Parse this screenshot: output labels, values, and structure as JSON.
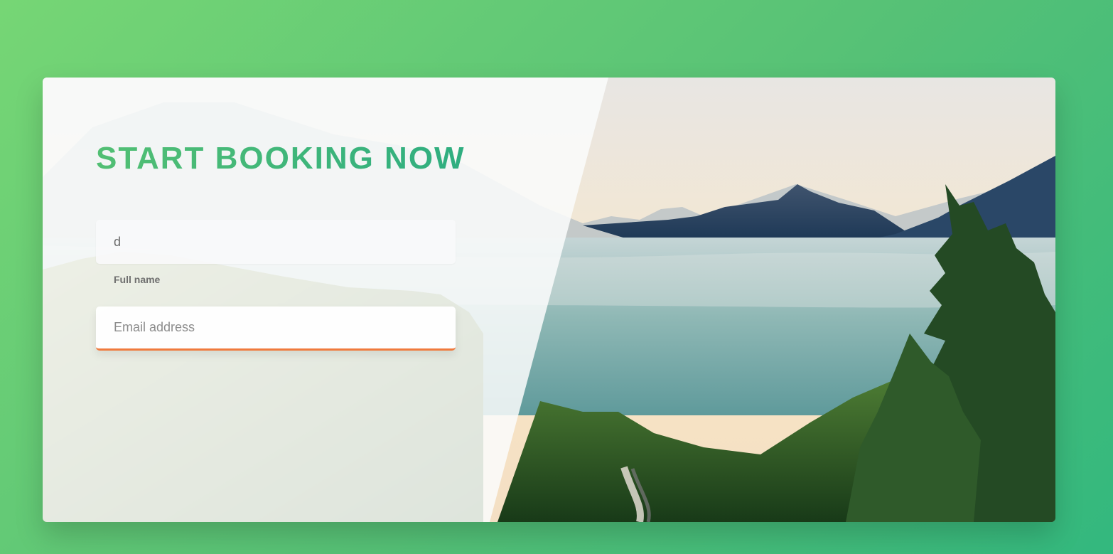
{
  "booking": {
    "title": "START BOOKING NOW",
    "full_name_value": "d",
    "full_name_label": "Full name",
    "email_placeholder": "Email address",
    "email_value": ""
  },
  "colors": {
    "page_gradient_start": "#76d675",
    "page_gradient_end": "#33b87e",
    "title_color": "#44b77a",
    "active_input_underline": "#f07a3d"
  }
}
